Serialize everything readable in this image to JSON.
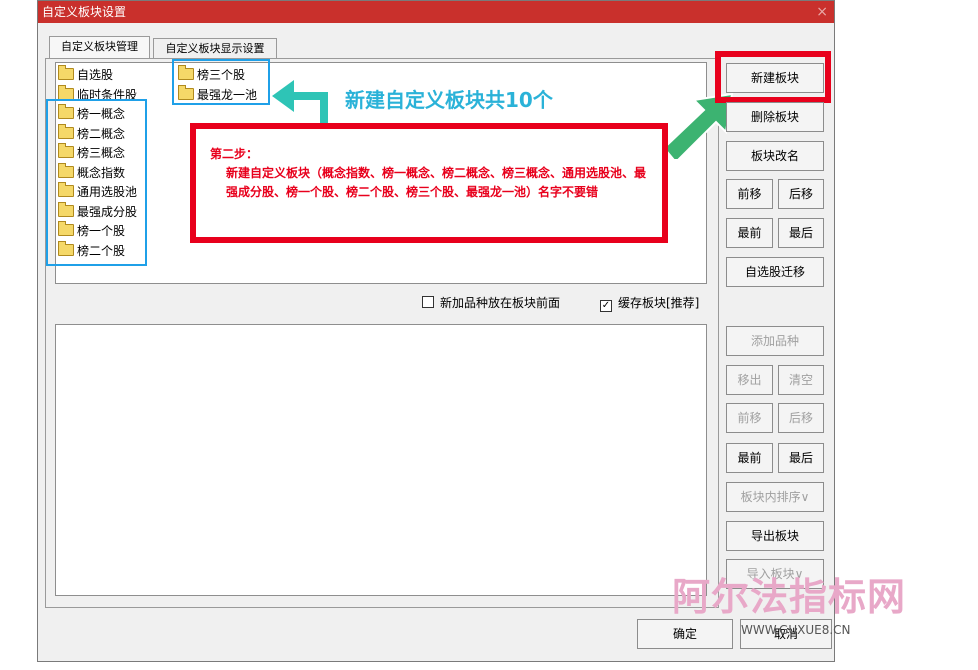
{
  "window": {
    "title": "自定义板块设置",
    "close_glyph": "×"
  },
  "tabs": [
    {
      "label": "自定义板块管理",
      "active": true
    },
    {
      "label": "自定义板块显示设置",
      "active": false
    }
  ],
  "blocks": {
    "col1": [
      "自选股",
      "临时条件股",
      "榜一概念",
      "榜二概念",
      "榜三概念",
      "概念指数",
      "通用选股池",
      "最强成分股",
      "榜一个股",
      "榜二个股"
    ],
    "col2": [
      "榜三个股",
      "最强龙一池"
    ]
  },
  "right_buttons": {
    "new_block": "新建板块",
    "delete_block": "删除板块",
    "rename_block": "板块改名",
    "move_up": "前移",
    "move_down": "后移",
    "move_first": "最前",
    "move_last": "最后",
    "migrate_watchlist": "自选股迁移"
  },
  "options": {
    "add_front_label": "新加品种放在板块前面",
    "add_front_checked": false,
    "cache_label": "缓存板块[推荐]",
    "cache_checked": true
  },
  "lower_buttons": {
    "add_item": "添加品种",
    "remove": "移出",
    "clear": "清空",
    "move_up": "前移",
    "move_down": "后移",
    "move_first": "最前",
    "move_last": "最后",
    "sort": "板块内排序∨",
    "export": "导出板块",
    "import": "导入板块∨"
  },
  "footer": {
    "ok": "确定",
    "cancel": "取消"
  },
  "annotations": {
    "headline": "新建自定义板块共10个",
    "step_title": "第二步：",
    "step_body": "新建自定义板块（概念指数、榜一概念、榜二概念、榜三概念、通用选股池、最强成分股、榜一个股、榜二个股、榜三个股、最强龙一池）名字不要错",
    "colors": {
      "red": "#e8001c",
      "blue": "#1fa0e8",
      "green_arrow": "#3cb371",
      "teal_arrow": "#2ec4b6"
    }
  },
  "watermark": {
    "text": "阿尔法指标网",
    "url": "WWW.GUXUE8.CN"
  }
}
